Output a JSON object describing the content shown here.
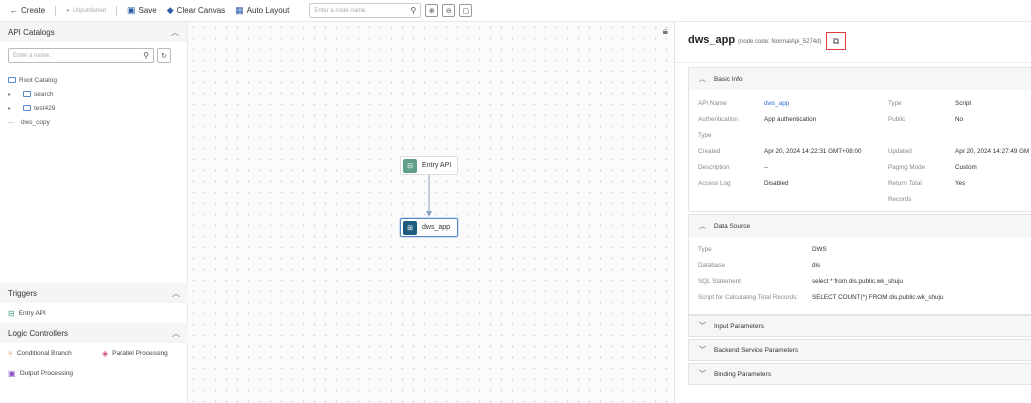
{
  "toolbar": {
    "back_label": "Create",
    "status_label": "Unpublished",
    "save_label": "Save",
    "clear_label": "Clear Canvas",
    "auto_layout_label": "Auto Layout",
    "search_placeholder": "Enter a node name."
  },
  "left": {
    "catalog_title": "API Catalogs",
    "search_placeholder": "Enter a name.",
    "tree": [
      {
        "label": "Root Catalog",
        "type": "folder",
        "indent": 0
      },
      {
        "label": "search",
        "type": "folder",
        "indent": 1
      },
      {
        "label": "test429",
        "type": "folder",
        "indent": 1
      },
      {
        "label": "dws_copy",
        "type": "item",
        "indent": 1
      }
    ],
    "triggers_title": "Triggers",
    "triggers": [
      "Entry API"
    ],
    "logic_title": "Logic Controllers",
    "logic_items": [
      "Conditional Branch",
      "Parallel Processing",
      "Output Processing"
    ]
  },
  "canvas": {
    "nodes": [
      {
        "label": "Entry API",
        "color": "#5f9f8a"
      },
      {
        "label": "dws_app",
        "color": "#1e5b7c"
      }
    ]
  },
  "right": {
    "name": "dws_app",
    "node_code": "(node code: NormalApi_5274d)",
    "basic_info": {
      "title": "Basic Info",
      "api_name_k": "API Name",
      "api_name_v": "dws_app",
      "type_k": "Type",
      "type_v": "Script",
      "auth_k1": "Authentication",
      "auth_k2": "Type",
      "auth_v": "App authentication",
      "public_k": "Public",
      "public_v": "No",
      "created_k": "Created",
      "created_v": "Apr 20, 2024 14:22:31 GMT+08:00",
      "updated_k": "Updated",
      "updated_v": "Apr 20, 2024 14:27:49 GM",
      "desc_k": "Description",
      "desc_v": "--",
      "paging_k": "Paging Mode",
      "paging_v": "Custom",
      "access_k": "Access Log",
      "access_v": "Disabled",
      "total_k1": "Return Total",
      "total_k2": "Records",
      "total_v": "Yes"
    },
    "data_source": {
      "title": "Data Source",
      "type_k": "Type",
      "type_v": "DWS",
      "db_k": "Database",
      "db_v": "dis",
      "sql_k": "SQL Statement",
      "sql_v": "select * from dis.public.wk_shuju",
      "script_k": "Script for Calculating Total Records:",
      "script_v": "SELECT COUNT(*) FROM dis.public.wk_shuju"
    },
    "input_params": "Input Parameters",
    "backend_params": "Backend Service Parameters",
    "binding_params": "Binding Parameters"
  }
}
